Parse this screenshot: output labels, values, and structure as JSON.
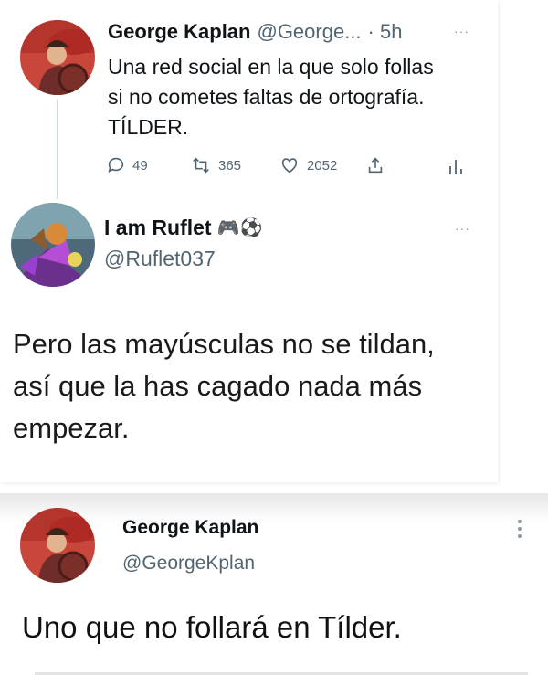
{
  "tweet1": {
    "author_name": "George Kaplan",
    "handle": "@George...",
    "time": "· 5h",
    "lines": [
      "Una red social en la que solo follas",
      "si no cometes faltas de ortografía.",
      "TÍLDER."
    ],
    "replies": "49",
    "retweets": "365",
    "likes": "2052",
    "more_icon": "ellipsis-icon"
  },
  "tweet2": {
    "author_name": "I am Ruflet",
    "emojis": "🎮⚽",
    "handle": "@Ruflet037",
    "lines": [
      "Pero las mayúsculas no se tildan,",
      "así que la has cagado nada más",
      "empezar."
    ],
    "more_icon": "ellipsis-icon"
  },
  "tweet3": {
    "author_name": "George Kaplan",
    "handle": "@GeorgeKplan",
    "text": "Uno que no follará en Tílder.",
    "more_icon": "kebab-icon"
  },
  "colors": {
    "text": "#0f1419",
    "muted": "#536471",
    "thread_line": "#cfd9de"
  }
}
